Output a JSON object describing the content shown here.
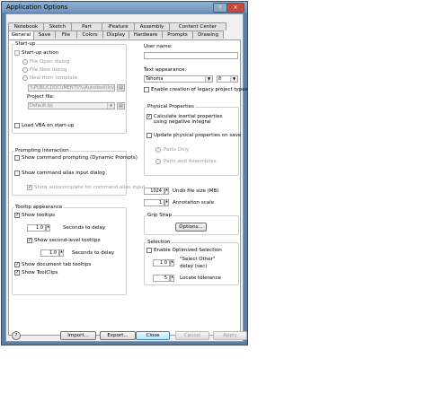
{
  "window": {
    "title": "Application Options",
    "help_glyph": "?",
    "close_glyph": "✕"
  },
  "tabs_row1": [
    "Notebook",
    "Sketch",
    "Part",
    "iFeature",
    "Assembly",
    "Content Center"
  ],
  "tabs_row2": [
    "General",
    "Save",
    "File",
    "Colors",
    "Display",
    "Hardware",
    "Prompts",
    "Drawing"
  ],
  "startup": {
    "group_title": "Start-up",
    "action_label": "Start-up action",
    "opt_open": "File Open dialog",
    "opt_new": "File New dialog",
    "opt_template": "New from template",
    "template_path": "%PUBLICDOCUMENTS%\\Autodesk\\Inv",
    "project_label": "Project file:",
    "project_value": "Default.ipj",
    "vba_label": "Load VBA on start-up"
  },
  "prompting": {
    "group_title": "Prompting interaction",
    "cmd_prompting": "Show command prompting (Dynamic Prompts)",
    "alias_dialog": "Show command alias input dialog",
    "autocomplete": "Show autocomplete for command alias input"
  },
  "tooltip": {
    "group_title": "Tooltip appearance",
    "show_tooltips": "Show tooltips",
    "delay1_value": "1.0",
    "delay1_label": "Seconds to delay",
    "second_level": "Show second-level tooltips",
    "delay2_value": "1.0",
    "delay2_label": "Seconds to delay",
    "doc_tab": "Show document tab tooltips",
    "toolclips": "Show ToolClips"
  },
  "right": {
    "user_name_label": "User name:",
    "user_name_value": "",
    "text_appearance_label": "Text appearance:",
    "font_value": "Tahoma",
    "size_value": "8",
    "legacy_label": "Enable creation of legacy project types",
    "physical_title": "Physical Properties",
    "calc_inertial": "Calculate inertial properties using negative integral",
    "update_save": "Update physical properties on save",
    "parts_only": "Parts Only",
    "parts_assemblies": "Parts and Assemblies",
    "undo_value": "1024",
    "undo_label": "Undo file size (MB)",
    "annot_value": "1",
    "annot_label": "Annotation scale",
    "grip_title": "Grip Snap",
    "options_btn": "Options...",
    "selection_title": "Selection",
    "optimized_label": "Enable Optimized Selection",
    "select_other_label": "\"Select Other\" delay (sec)",
    "select_other_value": "1.0",
    "locate_value": "5",
    "locate_label": "Locate tolerance"
  },
  "footer": {
    "help_glyph": "?",
    "import": "Import...",
    "export": "Export...",
    "close": "Close",
    "cancel": "Cancel",
    "apply": "Apply"
  },
  "glyphs": {
    "check": "✓",
    "down": "▼",
    "up": "▲",
    "browse": "▤"
  }
}
